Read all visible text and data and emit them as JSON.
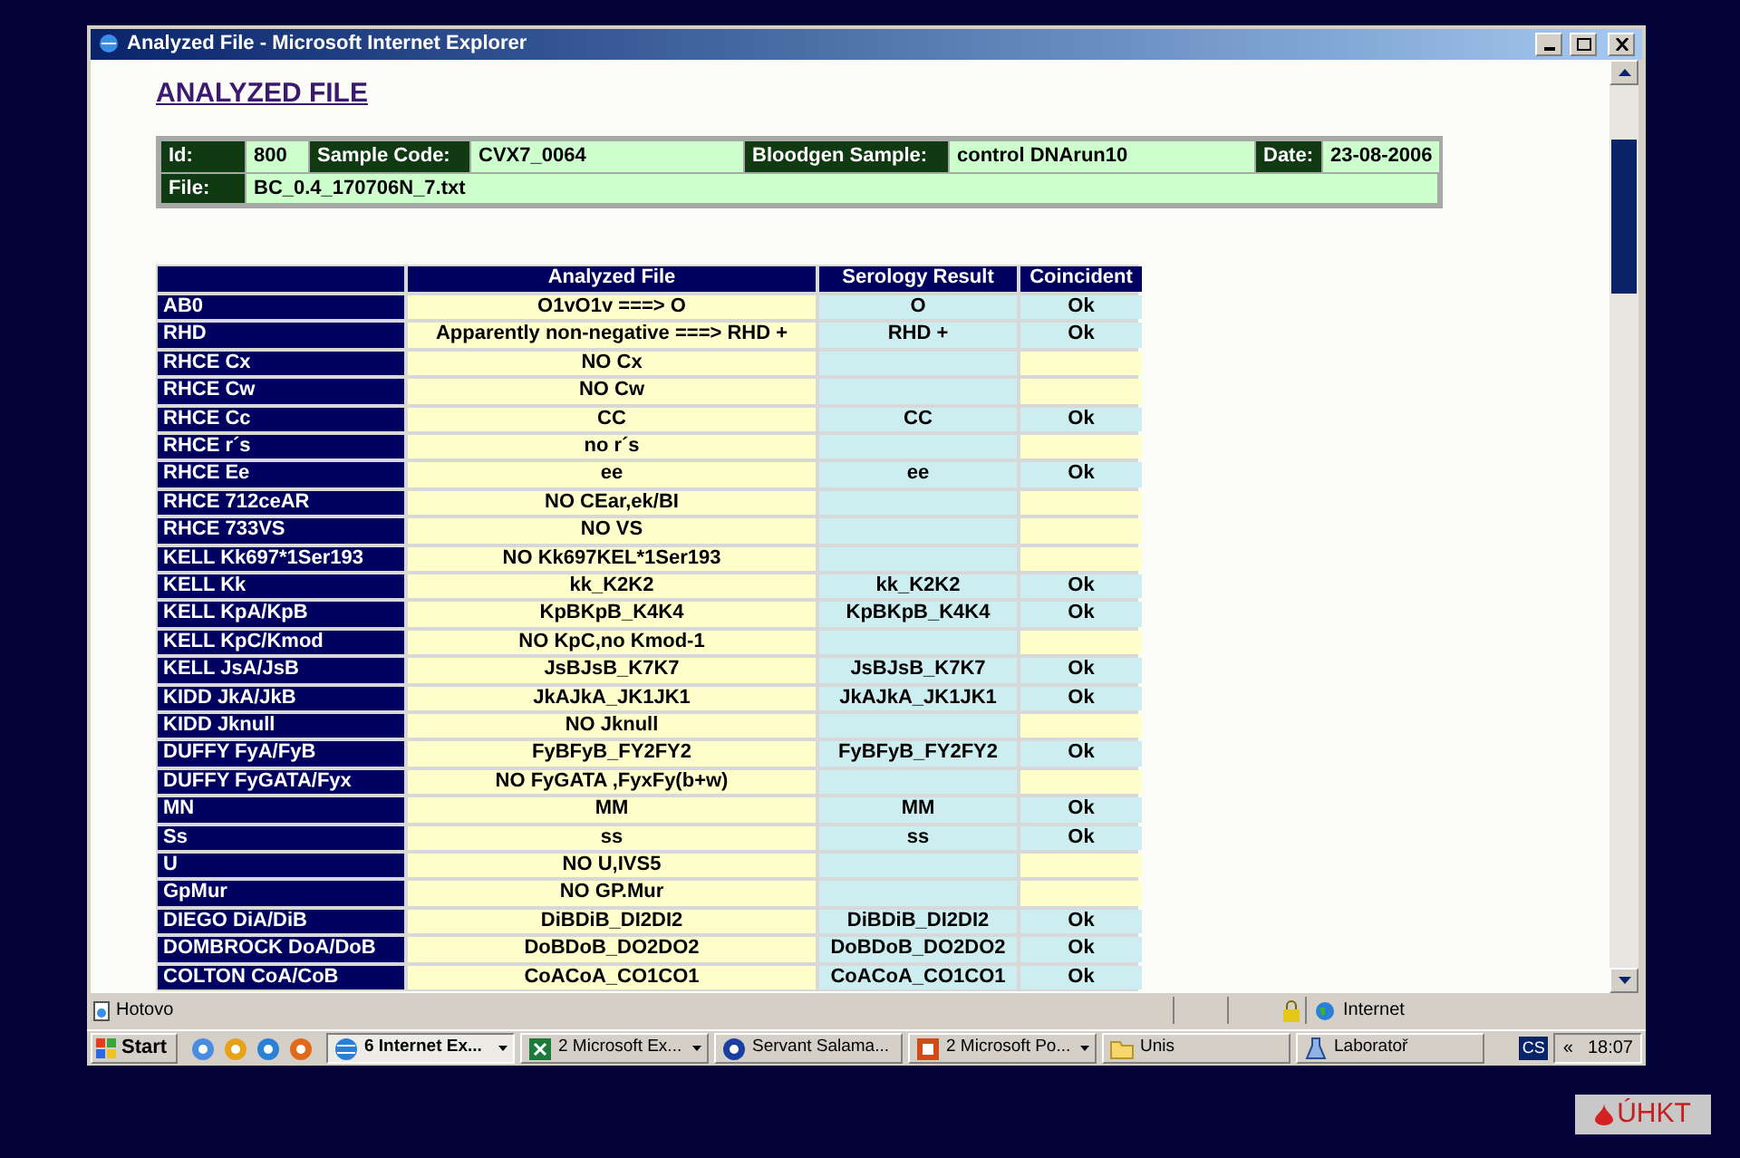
{
  "window": {
    "title": "Analyzed File - Microsoft Internet Explorer"
  },
  "page": {
    "heading": "ANALYZED FILE",
    "info": {
      "row1": [
        {
          "label": "Id:",
          "value": "800"
        },
        {
          "label": "Sample Code:",
          "value": "CVX7_0064"
        },
        {
          "label": "Bloodgen Sample:",
          "value": "control DNArun10"
        },
        {
          "label": "Date:",
          "value": "23-08-2006"
        }
      ],
      "row2": {
        "label": "File:",
        "value": "BC_0.4_170706N_7.txt"
      }
    },
    "table": {
      "columns": [
        "Analyzed File",
        "Serology Result",
        "Coincident"
      ],
      "rows": [
        {
          "label": "AB0",
          "analyzed": "O1vO1v ===> O",
          "serology": "O",
          "coincident": "Ok"
        },
        {
          "label": "RHD",
          "analyzed": "Apparently non-negative ===> RHD +",
          "serology": "RHD +",
          "coincident": "Ok"
        },
        {
          "label": "RHCE Cx",
          "analyzed": "NO Cx"
        },
        {
          "label": "RHCE Cw",
          "analyzed": "NO Cw"
        },
        {
          "label": "RHCE Cc",
          "analyzed": "CC",
          "serology": "CC",
          "coincident": "Ok"
        },
        {
          "label": "RHCE r´s",
          "analyzed": "no r´s"
        },
        {
          "label": "RHCE Ee",
          "analyzed": "ee",
          "serology": "ee",
          "coincident": "Ok"
        },
        {
          "label": "RHCE 712ceAR",
          "analyzed": "NO CEar,ek/BI"
        },
        {
          "label": "RHCE 733VS",
          "analyzed": "NO VS"
        },
        {
          "label": "KELL Kk697*1Ser193",
          "analyzed": "NO Kk697KEL*1Ser193"
        },
        {
          "label": "KELL Kk",
          "analyzed": "kk_K2K2",
          "serology": "kk_K2K2",
          "coincident": "Ok"
        },
        {
          "label": "KELL KpA/KpB",
          "analyzed": "KpBKpB_K4K4",
          "serology": "KpBKpB_K4K4",
          "coincident": "Ok"
        },
        {
          "label": "KELL KpC/Kmod",
          "analyzed": "NO KpC,no Kmod-1"
        },
        {
          "label": "KELL JsA/JsB",
          "analyzed": "JsBJsB_K7K7",
          "serology": "JsBJsB_K7K7",
          "coincident": "Ok"
        },
        {
          "label": "KIDD JkA/JkB",
          "analyzed": "JkAJkA_JK1JK1",
          "serology": "JkAJkA_JK1JK1",
          "coincident": "Ok"
        },
        {
          "label": "KIDD Jknull",
          "analyzed": "NO Jknull"
        },
        {
          "label": "DUFFY FyA/FyB",
          "analyzed": "FyBFyB_FY2FY2",
          "serology": "FyBFyB_FY2FY2",
          "coincident": "Ok"
        },
        {
          "label": "DUFFY FyGATA/Fyx",
          "analyzed": "NO FyGATA ,FyxFy(b+w)"
        },
        {
          "label": "MN",
          "analyzed": "MM",
          "serology": "MM",
          "coincident": "Ok"
        },
        {
          "label": "Ss",
          "analyzed": "ss",
          "serology": "ss",
          "coincident": "Ok"
        },
        {
          "label": "U",
          "analyzed": "NO U,IVS5"
        },
        {
          "label": "GpMur",
          "analyzed": "NO GP.Mur"
        },
        {
          "label": "DIEGO DiA/DiB",
          "analyzed": "DiBDiB_DI2DI2",
          "serology": "DiBDiB_DI2DI2",
          "coincident": "Ok"
        },
        {
          "label": "DOMBROCK DoA/DoB",
          "analyzed": "DoBDoB_DO2DO2",
          "serology": "DoBDoB_DO2DO2",
          "coincident": "Ok"
        },
        {
          "label": "COLTON CoA/CoB",
          "analyzed": "CoACoA_CO1CO1",
          "serology": "CoACoA_CO1CO1",
          "coincident": "Ok"
        }
      ]
    }
  },
  "status_bar": {
    "text": "Hotovo",
    "zone": "Internet"
  },
  "taskbar": {
    "start": "Start",
    "tasks": [
      {
        "label": "6 Internet Ex...",
        "grouped": true,
        "selected": true
      },
      {
        "label": "2 Microsoft Ex...",
        "grouped": true,
        "selected": false
      },
      {
        "label": "Servant Salama...",
        "grouped": false,
        "selected": false
      },
      {
        "label": "2 Microsoft Po...",
        "grouped": true,
        "selected": false
      },
      {
        "label": "Unis",
        "grouped": false,
        "selected": false
      },
      {
        "label": "Laboratoř",
        "grouped": false,
        "selected": false
      }
    ],
    "language": "CS",
    "expand": "«",
    "clock": "18:07"
  },
  "logo": "ÚHKT"
}
